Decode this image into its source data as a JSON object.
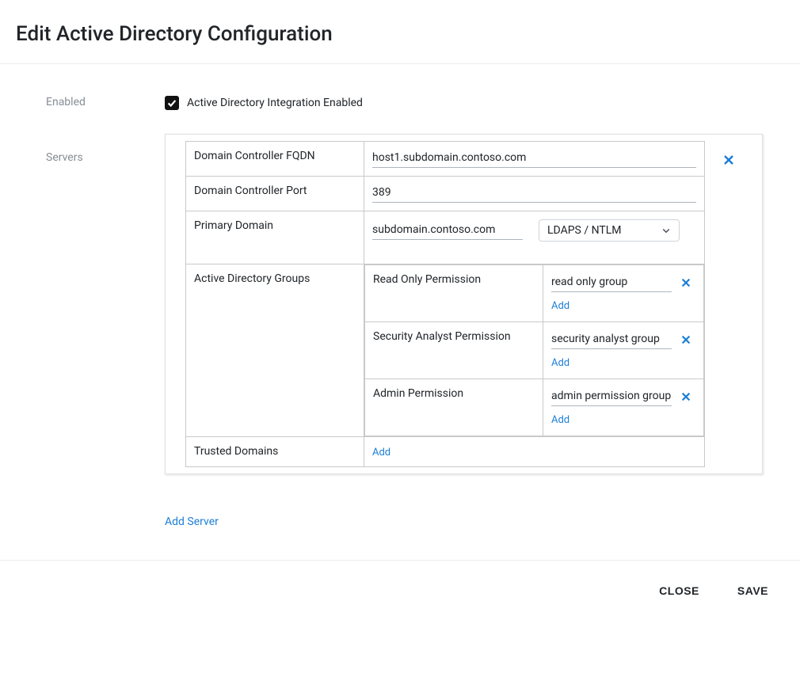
{
  "header": {
    "title": "Edit Active Directory Configuration"
  },
  "enabled_row": {
    "label": "Enabled",
    "checkbox_label": "Active Directory Integration Enabled",
    "checked": true
  },
  "servers_row": {
    "label": "Servers"
  },
  "server": {
    "fields": {
      "fqdn_label": "Domain Controller FQDN",
      "fqdn_value": "host1.subdomain.contoso.com",
      "port_label": "Domain Controller Port",
      "port_value": "389",
      "primary_domain_label": "Primary Domain",
      "primary_domain_value": "subdomain.contoso.com",
      "auth_type_selected": "LDAPS / NTLM",
      "groups_label": "Active Directory Groups",
      "trusted_domains_label": "Trusted Domains"
    },
    "groups": {
      "read": {
        "label": "Read Only Permission",
        "value": "read only group"
      },
      "analyst": {
        "label": "Security Analyst Permission",
        "value": "security analyst group"
      },
      "admin": {
        "label": "Admin Permission",
        "value": "admin permission group"
      }
    }
  },
  "actions": {
    "add_label": "Add",
    "add_server_label": "Add Server",
    "close_label": "CLOSE",
    "save_label": "SAVE"
  }
}
